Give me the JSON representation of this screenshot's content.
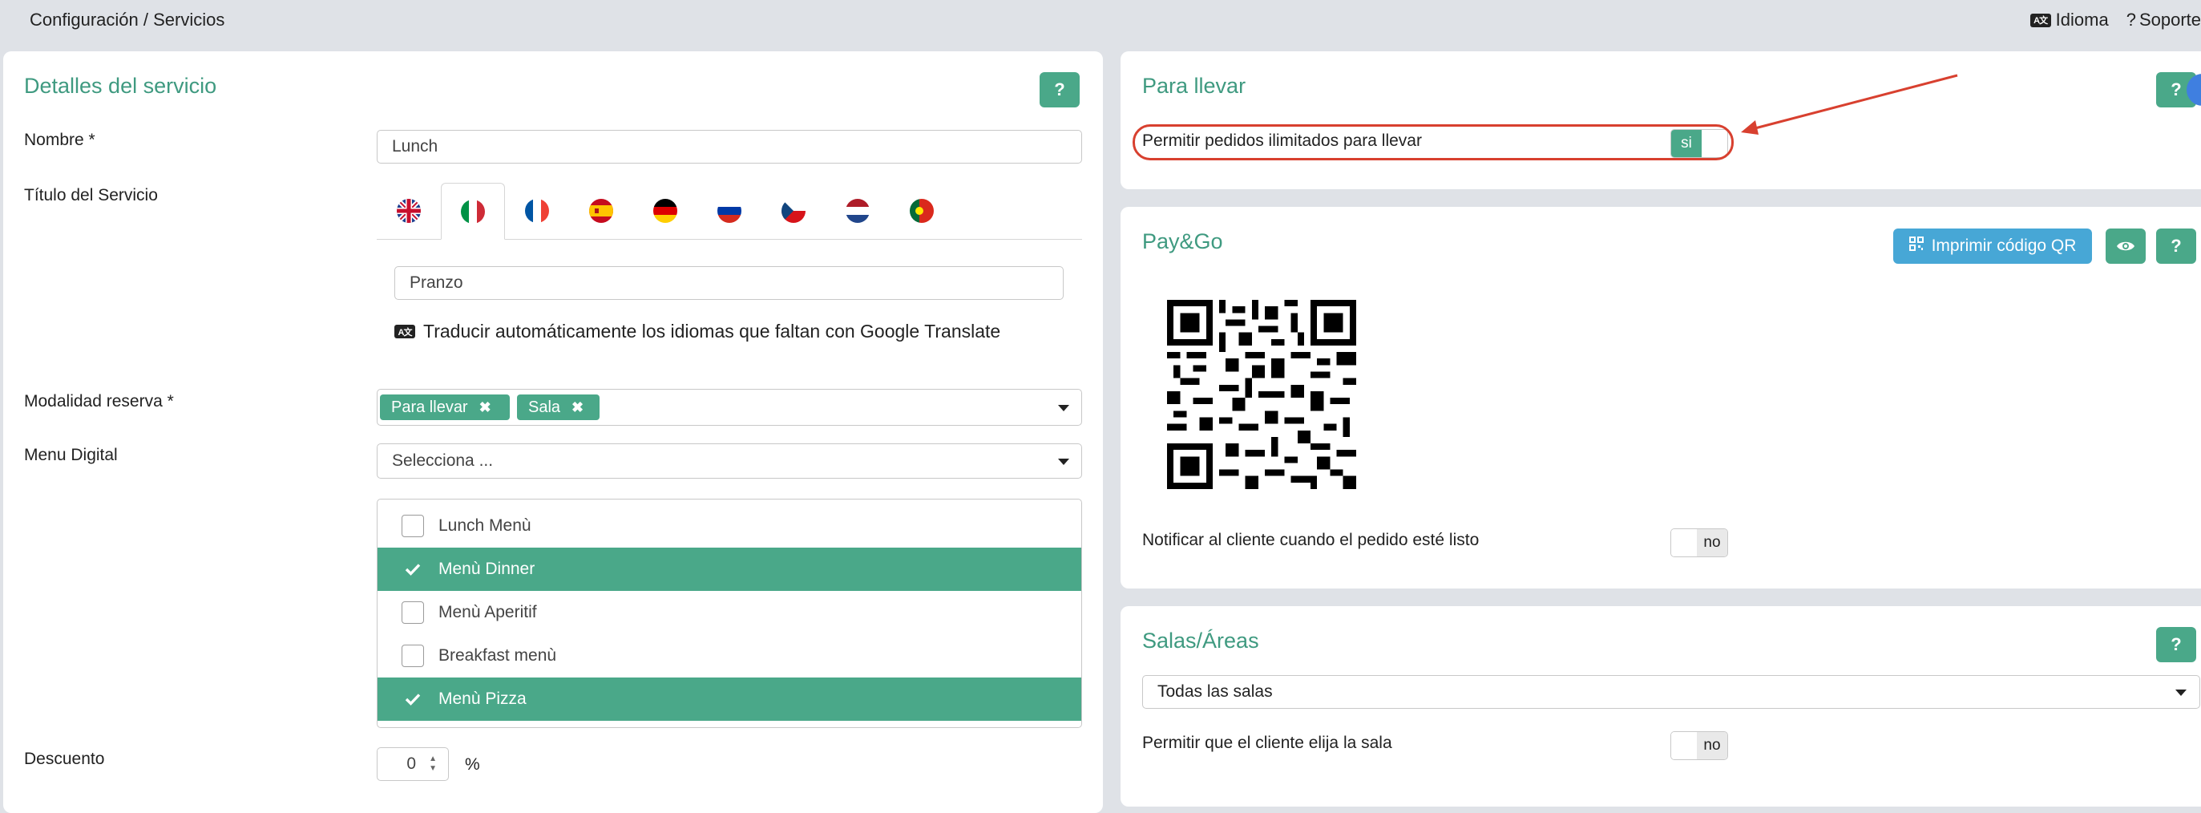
{
  "topbar": {
    "breadcrumb": "Configuración / Servicios",
    "language_badge": "A文",
    "language_label": "Idioma",
    "support_icon": "?",
    "support_label": "Soporte"
  },
  "service_details": {
    "title": "Detalles del servicio",
    "help": "?",
    "name_label": "Nombre *",
    "name_value": "Lunch",
    "service_title_label": "Título del Servicio",
    "language_tabs": [
      {
        "icon": "flag-uk-icon",
        "active": false
      },
      {
        "icon": "flag-it-icon",
        "active": true
      },
      {
        "icon": "flag-fr-icon",
        "active": false
      },
      {
        "icon": "flag-es-icon",
        "active": false
      },
      {
        "icon": "flag-de-icon",
        "active": false
      },
      {
        "icon": "flag-ru-icon",
        "active": false
      },
      {
        "icon": "flag-cz-icon",
        "active": false
      },
      {
        "icon": "flag-nl-icon",
        "active": false
      },
      {
        "icon": "flag-pt-icon",
        "active": false
      }
    ],
    "service_title_value": "Pranzo",
    "translate_badge": "A文",
    "translate_text": "Traducir automáticamente los idiomas que faltan con Google Translate",
    "booking_mode_label": "Modalidad reserva *",
    "booking_mode_tags": [
      "Para llevar",
      "Sala"
    ],
    "digital_menu_label": "Menu Digital",
    "digital_menu_placeholder": "Selecciona ...",
    "menu_options": [
      {
        "label": "Lunch Menù",
        "selected": false
      },
      {
        "label": "Menù Dinner",
        "selected": true
      },
      {
        "label": "Menù Aperitif",
        "selected": false
      },
      {
        "label": "Breakfast menù",
        "selected": false
      },
      {
        "label": "Menù Pizza",
        "selected": true
      }
    ],
    "discount_label": "Descuento",
    "discount_value": "0",
    "discount_unit": "%"
  },
  "takeaway": {
    "title": "Para llevar",
    "help": "?",
    "unlimited_label": "Permitir pedidos ilimitados para llevar",
    "unlimited_toggle": "si"
  },
  "paygo": {
    "title": "Pay&Go",
    "print_qr_label": "Imprimir código QR",
    "help": "?",
    "notify_label": "Notificar al cliente cuando el pedido esté listo",
    "notify_toggle": "no"
  },
  "rooms": {
    "title": "Salas/Áreas",
    "help": "?",
    "room_select": "Todas las salas",
    "choose_room_label": "Permitir que el cliente elija la sala",
    "choose_room_toggle": "no"
  },
  "colors": {
    "accent": "#4aa889",
    "title_green": "#3f9a80",
    "qr_button": "#47a7d6",
    "annotation_red": "#d8402f",
    "background": "#dfe2e7"
  }
}
